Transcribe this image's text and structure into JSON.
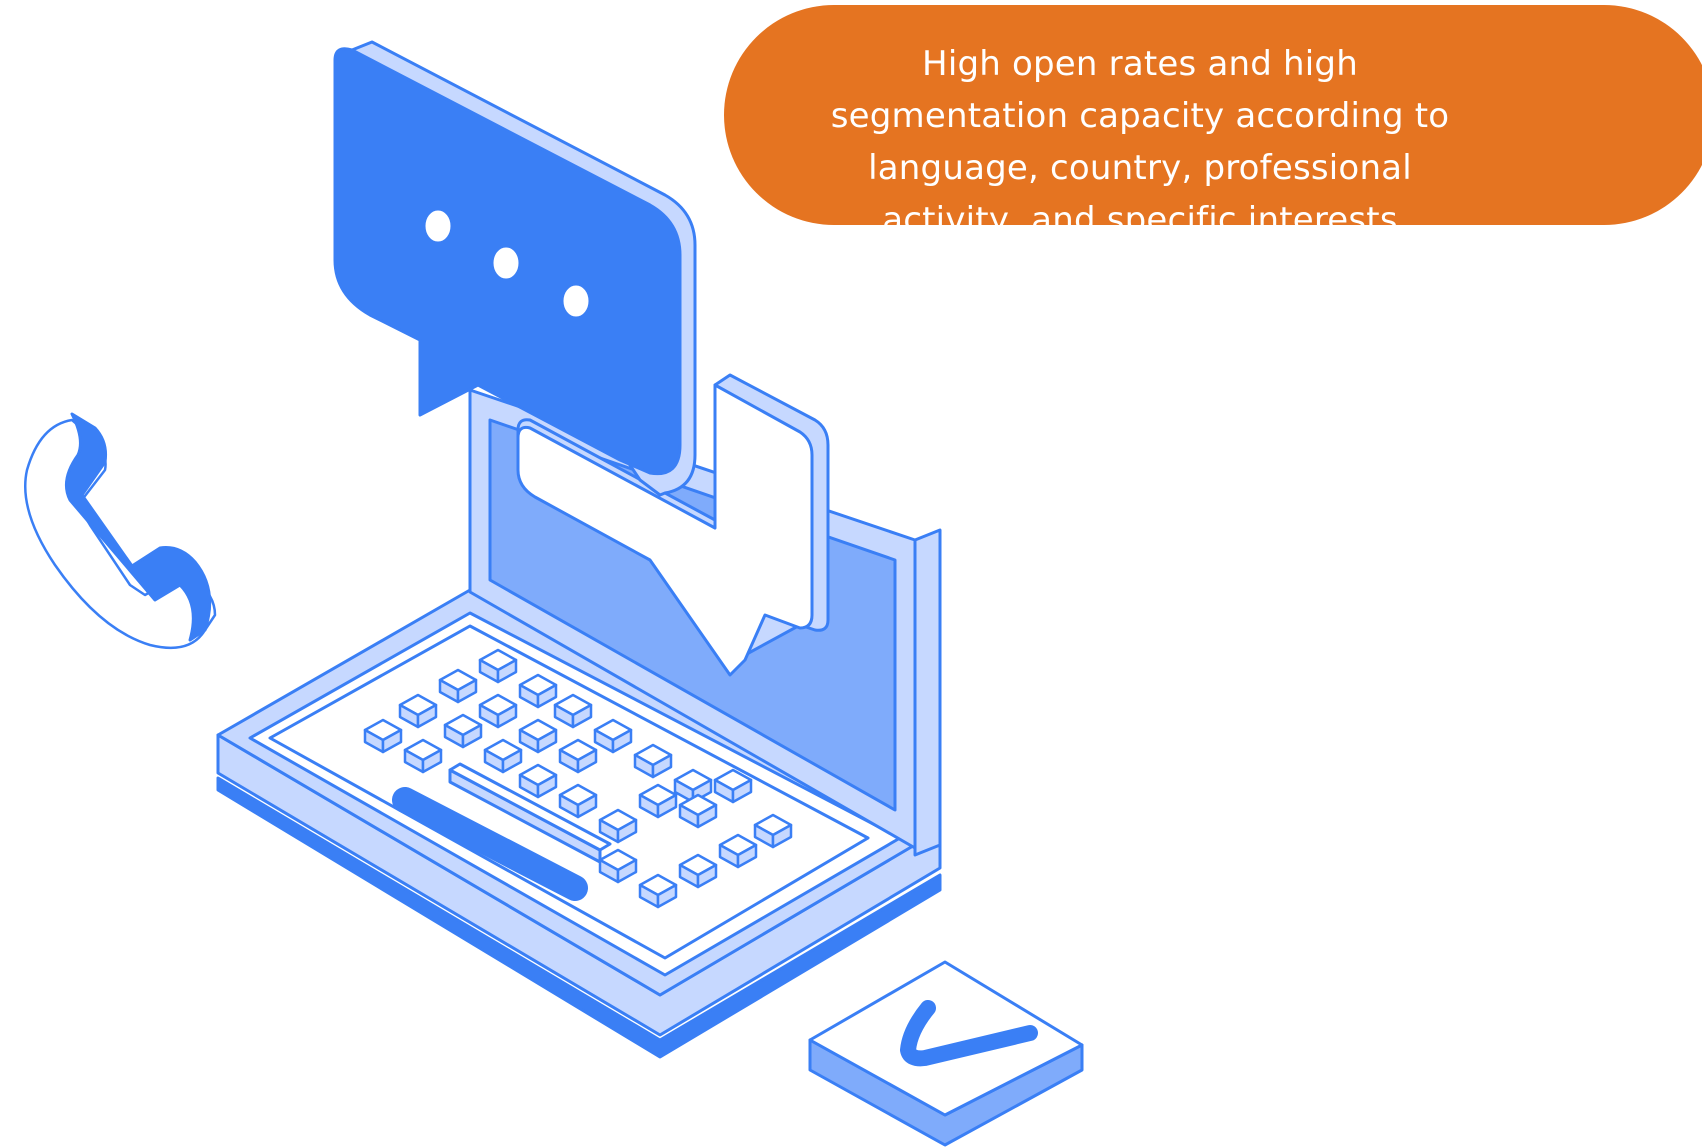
{
  "callout": {
    "text": "High open rates and high segmentation capacity according to language, country, professional activity, and specific interests"
  },
  "illustration": {
    "icons": [
      "laptop-icon",
      "speech-bubble-icon",
      "phone-handset-icon",
      "checkmark-icon"
    ],
    "colors": {
      "primary_blue": "#3a7ff5",
      "light_blue": "#c6d8ff",
      "mid_blue": "#7fabfb",
      "white": "#ffffff",
      "callout_orange": "#e57421"
    }
  }
}
